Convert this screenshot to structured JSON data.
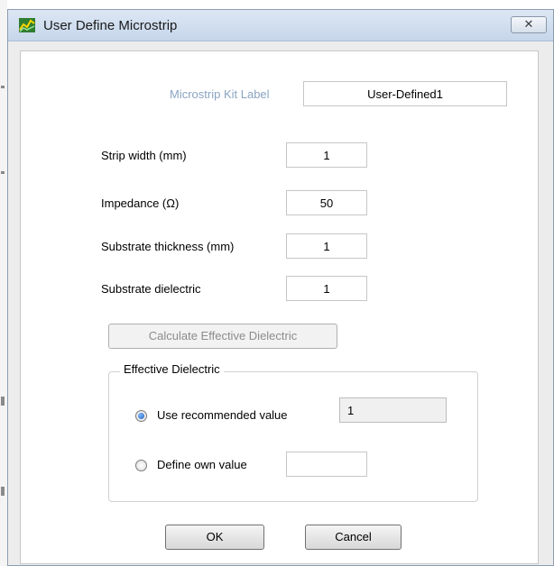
{
  "window": {
    "title": "User Define Microstrip",
    "close_glyph": "✕",
    "icon": "microstrip-app-icon"
  },
  "kit_label": {
    "label": "Microstrip Kit Label",
    "value": "User-Defined1"
  },
  "fields": [
    {
      "label": "Strip width (mm)",
      "value": "1"
    },
    {
      "label": "Impedance (Ω)",
      "value": "50"
    },
    {
      "label": "Substrate thickness (mm)",
      "value": "1"
    },
    {
      "label": "Substrate dielectric",
      "value": "1"
    }
  ],
  "calculate_button": {
    "label": "Calculate Effective Dielectric",
    "enabled": false
  },
  "effective_dielectric": {
    "title": "Effective Dielectric",
    "use_recommended": {
      "label": "Use recommended value",
      "value": "1",
      "checked": true
    },
    "define_own": {
      "label": "Define own value",
      "value": "",
      "checked": false
    }
  },
  "buttons": {
    "ok": "OK",
    "cancel": "Cancel"
  }
}
